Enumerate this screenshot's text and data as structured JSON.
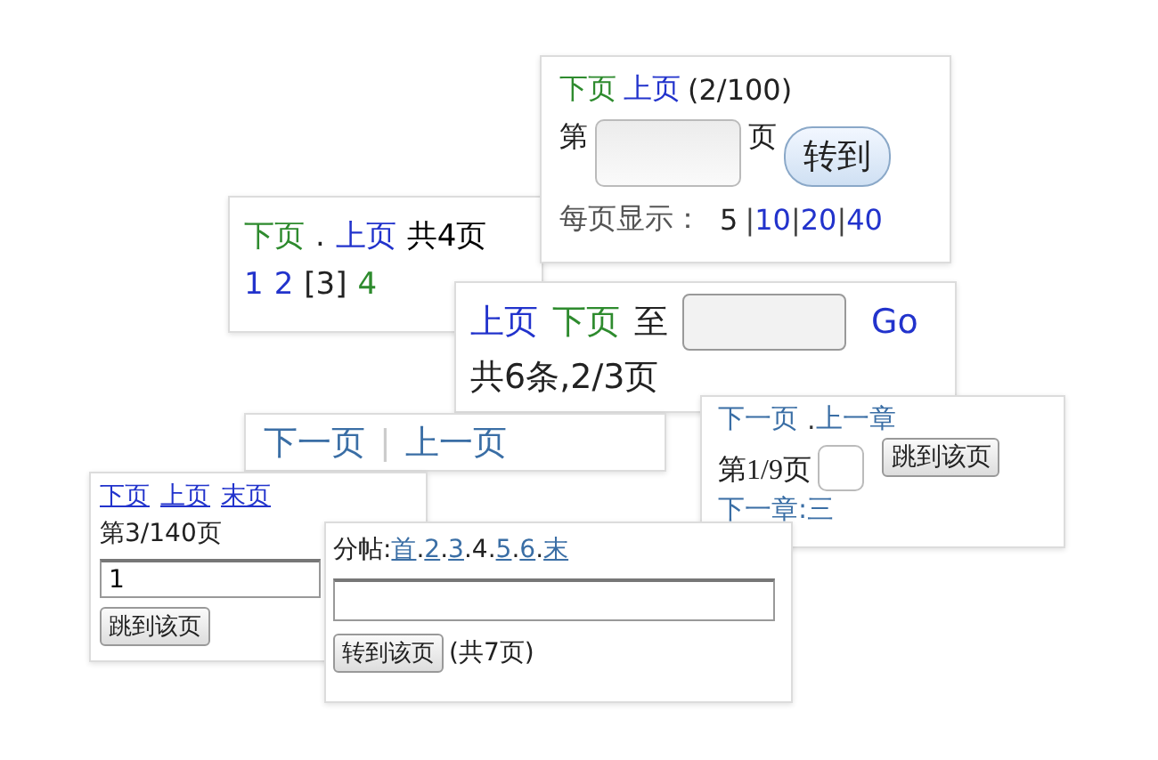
{
  "card_b": {
    "links": [
      {
        "label": "下页",
        "color": "#2e8b2e"
      },
      {
        "label": ".",
        "color": "#222222"
      },
      {
        "label": "上页",
        "color": "#2233cc"
      }
    ],
    "total": "共4页",
    "pages": [
      {
        "label": "1",
        "color": "#2233cc"
      },
      {
        "label": "2",
        "color": "#2233cc"
      },
      {
        "label": "[3]",
        "color": "#222222"
      },
      {
        "label": "4",
        "color": "#2e8b2e"
      }
    ]
  },
  "card_a": {
    "links": [
      {
        "label": "下页",
        "color": "#2e8b2e"
      },
      {
        "label": "上页",
        "color": "#2233cc"
      }
    ],
    "status": "(2/100)",
    "prefix": "第",
    "suffix": "页",
    "button": "转到",
    "per_page_label": "每页显示：",
    "per_page": [
      {
        "kind": "option",
        "label": "5",
        "selected": true
      },
      {
        "kind": "separator",
        "label": "|"
      },
      {
        "kind": "option",
        "label": "10",
        "selected": false
      },
      {
        "kind": "separator",
        "label": "|"
      },
      {
        "kind": "option",
        "label": "20",
        "selected": false
      },
      {
        "kind": "separator",
        "label": "|"
      },
      {
        "kind": "option",
        "label": "40",
        "selected": false
      }
    ]
  },
  "card_c": {
    "links": [
      {
        "label": "上页",
        "color": "#2233cc"
      },
      {
        "label": "下页",
        "color": "#2e8b2e"
      }
    ],
    "to": "至",
    "go": "Go",
    "summary": "共6条,2/3页"
  },
  "card_e": {
    "next": "下一页",
    "separator": "|",
    "prev": "上一页"
  },
  "card_d": {
    "next": "下一页",
    "dot": ".",
    "prev_chapter": "上一章",
    "page": "第1/9页",
    "button": "跳到该页",
    "next_chapter": "下一章:三"
  },
  "card_f": {
    "links": [
      "下页",
      "上页",
      "末页"
    ],
    "page": "第3/140页",
    "input_value": "1",
    "button": "跳到该页"
  },
  "card_g": {
    "label": "分帖:",
    "items": [
      {
        "kind": "link",
        "label": "首",
        "after": "."
      },
      {
        "kind": "link",
        "label": "2",
        "after": "."
      },
      {
        "kind": "link",
        "label": "3",
        "after": "."
      },
      {
        "kind": "text",
        "label": "4",
        "after": "."
      },
      {
        "kind": "link",
        "label": "5",
        "after": "."
      },
      {
        "kind": "link",
        "label": "6",
        "after": "."
      },
      {
        "kind": "link",
        "label": "末"
      }
    ],
    "button": "转到该页",
    "total": "(共7页)"
  }
}
